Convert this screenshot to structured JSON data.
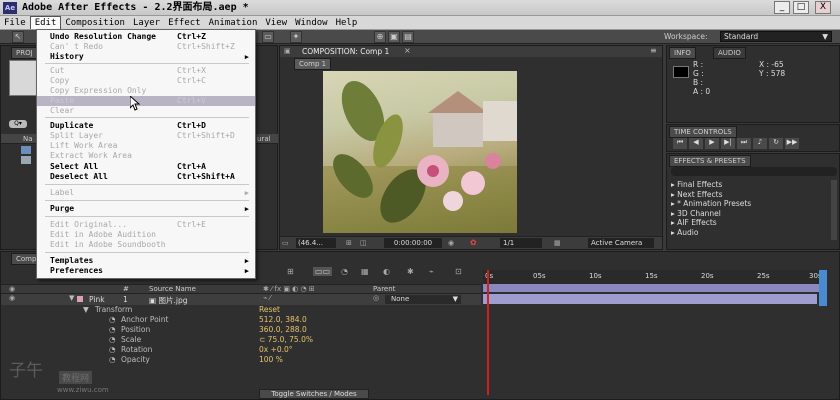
{
  "window": {
    "title": "Adobe After Effects - 2.2界面布局.aep *",
    "app_icon_text": "Ae",
    "min_glyph": "_",
    "max_glyph": "□",
    "close_glyph": "X"
  },
  "menubar": {
    "items": [
      "File",
      "Edit",
      "Composition",
      "Layer",
      "Effect",
      "Animation",
      "View",
      "Window",
      "Help"
    ]
  },
  "workspace": {
    "label": "Workspace:",
    "value": "Standard"
  },
  "edit_menu": {
    "items": [
      {
        "label": "Undo Resolution Change",
        "shortcut": "Ctrl+Z",
        "enabled": true
      },
      {
        "label": "Can' t Redo",
        "shortcut": "Ctrl+Shift+Z",
        "enabled": false
      },
      {
        "label": "History",
        "shortcut": "",
        "enabled": true,
        "submenu": true
      },
      {
        "label": "Cut",
        "shortcut": "Ctrl+X",
        "enabled": false
      },
      {
        "label": "Copy",
        "shortcut": "Ctrl+C",
        "enabled": false
      },
      {
        "label": "Copy Expression Only",
        "shortcut": "",
        "enabled": false
      },
      {
        "label": "Paste",
        "shortcut": "Ctrl+V",
        "enabled": false,
        "highlighted": true
      },
      {
        "label": "Clear",
        "shortcut": "",
        "enabled": false
      },
      {
        "label": "Duplicate",
        "shortcut": "Ctrl+D",
        "enabled": true,
        "bold": true
      },
      {
        "label": "Split Layer",
        "shortcut": "Ctrl+Shift+D",
        "enabled": false
      },
      {
        "label": "Lift Work Area",
        "shortcut": "",
        "enabled": false
      },
      {
        "label": "Extract Work Area",
        "shortcut": "",
        "enabled": false
      },
      {
        "label": "Select All",
        "shortcut": "Ctrl+A",
        "enabled": true,
        "bold": true
      },
      {
        "label": "Deselect All",
        "shortcut": "Ctrl+Shift+A",
        "enabled": true,
        "bold": true
      },
      {
        "label": "Label",
        "shortcut": "",
        "enabled": false,
        "submenu": true
      },
      {
        "label": "Purge",
        "shortcut": "",
        "enabled": true,
        "submenu": true
      },
      {
        "label": "Edit Original...",
        "shortcut": "Ctrl+E",
        "enabled": false
      },
      {
        "label": "Edit in Adobe Audition",
        "shortcut": "",
        "enabled": false
      },
      {
        "label": "Edit in Adobe Soundbooth",
        "shortcut": "",
        "enabled": false
      },
      {
        "label": "Templates",
        "shortcut": "",
        "enabled": true,
        "submenu": true
      },
      {
        "label": "Preferences",
        "shortcut": "",
        "enabled": true,
        "submenu": true
      }
    ]
  },
  "project_panel": {
    "tab": "PROJ",
    "col_name": "Na",
    "col_type": "ural"
  },
  "composition_panel": {
    "tab": "COMPOSITION: Comp 1",
    "subtab": "Comp 1",
    "zoom": "(46.4...",
    "timecode": "0:00:00:00",
    "resolution": "1/1",
    "camera": "Active Camera"
  },
  "info_panel": {
    "tabs": [
      "INFO",
      "AUDIO"
    ],
    "r": "R :",
    "g": "G :",
    "b": "B :",
    "a": "A : 0",
    "x": "X : -65",
    "y": "Y : 578"
  },
  "time_controls": {
    "tab": "TIME CONTROLS"
  },
  "effects_panel": {
    "tab": "EFFECTS & PRESETS",
    "items": [
      "Final Effects",
      "Next Effects",
      "* Animation Presets",
      "3D Channel",
      "AIF Effects",
      "Audio"
    ]
  },
  "timeline": {
    "tab": "Comp",
    "col_num": "#",
    "col_source": "Source Name",
    "col_parent": "Parent",
    "layer": {
      "label_name": "Pink",
      "number": "1",
      "source": "图片.jpg",
      "parent": "None"
    },
    "transform": {
      "label": "Transform",
      "reset": "Reset"
    },
    "props": [
      {
        "name": "Anchor Point",
        "value": "512.0, 384.0"
      },
      {
        "name": "Position",
        "value": "360.0, 288.0"
      },
      {
        "name": "Scale",
        "value": "⊂ 75.0, 75.0%"
      },
      {
        "name": "Rotation",
        "value": "0x +0.0°"
      },
      {
        "name": "Opacity",
        "value": "100 %"
      }
    ],
    "ruler": [
      "0s",
      "05s",
      "10s",
      "15s",
      "20s",
      "25s",
      "30s"
    ],
    "toggle_label": "Toggle Switches / Modes"
  },
  "watermark": {
    "line1": "子午",
    "line2": "教程网",
    "line3": "www.ziwu.com"
  },
  "colors": {
    "accent_yellow": "#e7c36a",
    "menu_highlight": "#b8b4c4",
    "workarea": "#9f9dd0",
    "playhead": "#d02020"
  }
}
